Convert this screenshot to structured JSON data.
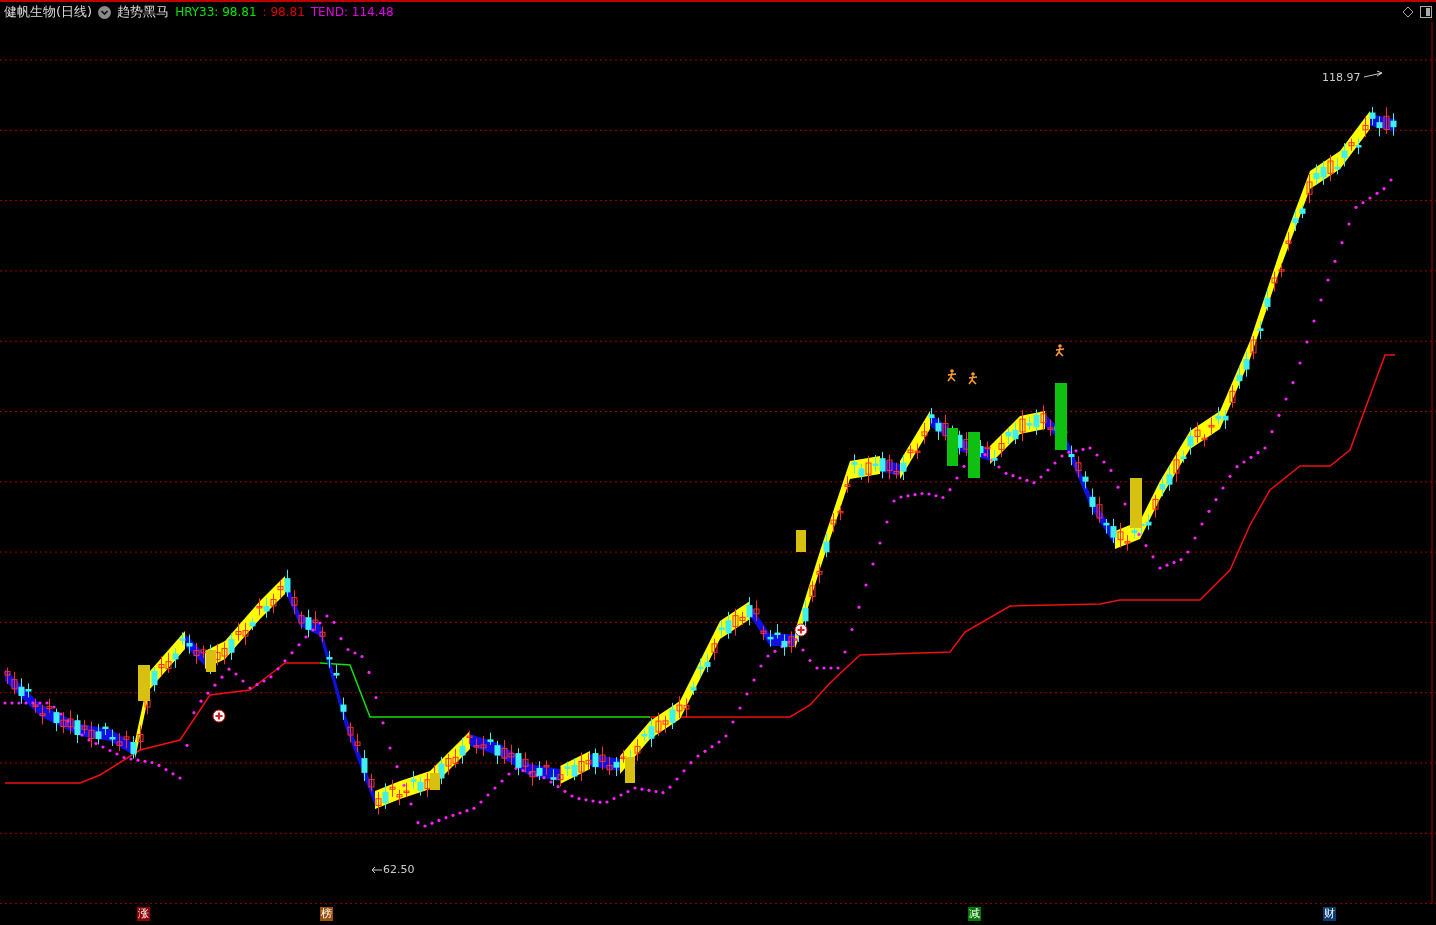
{
  "header": {
    "title": "健帆生物(日线)",
    "indicator_name": "趋势黑马",
    "readings": [
      {
        "text": "HRY33: 98.81",
        "color": "#00e600"
      },
      {
        "text": ": 98.81",
        "color": "#e00000"
      },
      {
        "text": "TEND: 114.48",
        "color": "#e600e6"
      }
    ]
  },
  "chart": {
    "max_label": "118.97",
    "min_label": "62.50"
  },
  "event_tags": [
    {
      "text": "涨",
      "color": "#8b0000"
    },
    {
      "text": "榜",
      "color": "#9a4f0a"
    },
    {
      "text": "减",
      "color": "#007a00"
    },
    {
      "text": "财",
      "color": "#0b3b6e"
    }
  ]
}
